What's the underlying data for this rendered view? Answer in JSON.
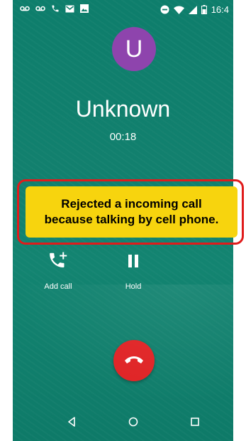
{
  "status_bar": {
    "time": "16:4",
    "left_icons": [
      "voicemail-icon",
      "voicemail-icon",
      "call-icon",
      "mail-icon",
      "image-icon"
    ],
    "right_icons": [
      "do-not-disturb-icon",
      "wifi-icon",
      "signal-icon",
      "battery-icon"
    ]
  },
  "call": {
    "avatar_letter": "U",
    "caller_name": "Unknown",
    "timer": "00:18",
    "overflow": "...",
    "actions": {
      "add_call": "Add call",
      "hold": "Hold"
    }
  },
  "callout": {
    "line1": "Rejected a incoming call",
    "line2": "because talking by cell phone."
  },
  "colors": {
    "background": "#12806e",
    "avatar": "#8e44ad",
    "end_call": "#e02426",
    "callout_bg": "#f7d40e",
    "callout_border": "#e01b1b"
  },
  "navbar": [
    "back-icon",
    "home-icon",
    "recents-icon"
  ]
}
